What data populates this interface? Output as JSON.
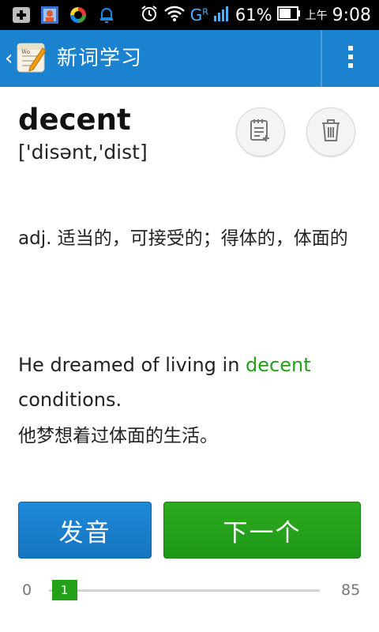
{
  "status_bar": {
    "battery_percent": "61%",
    "ampm": "上午",
    "time": "9:08",
    "network": "G",
    "network_sup": "R"
  },
  "action_bar": {
    "title": "新词学习"
  },
  "word": {
    "headword": "decent",
    "phonetic": "['disənt,'dist]",
    "definition": "adj. 适当的，可接受的；得体的，体面的"
  },
  "example": {
    "before": "He dreamed of living in ",
    "highlight": "decent",
    "after": " conditions.",
    "translation": "他梦想着过体面的生活。",
    "highlight_color": "#25a01b"
  },
  "buttons": {
    "pronounce": "发音",
    "next": "下一个"
  },
  "progress": {
    "min": "0",
    "max": "85",
    "current": "1",
    "current_value": 1,
    "max_value": 85
  },
  "colors": {
    "action_bar": "#1b82cf",
    "pronounce_button": "#1a7fcd",
    "next_button": "#25a01b"
  }
}
